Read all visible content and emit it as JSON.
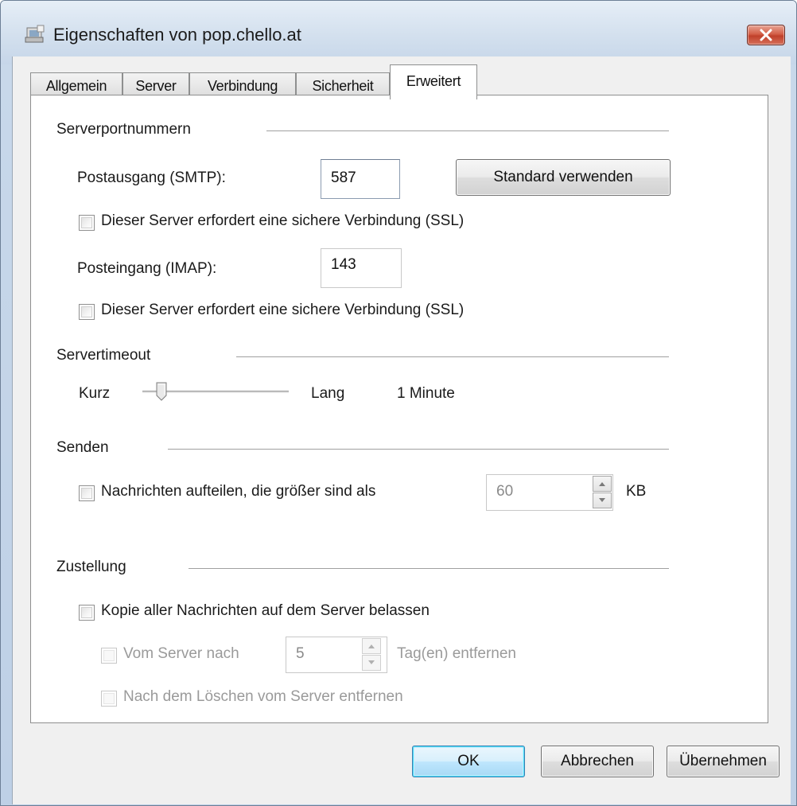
{
  "window": {
    "title": "Eigenschaften von pop.chello.at",
    "close_icon": "close-icon"
  },
  "tabs": [
    {
      "label": "Allgemein",
      "active": false
    },
    {
      "label": "Server",
      "active": false
    },
    {
      "label": "Verbindung",
      "active": false
    },
    {
      "label": "Sicherheit",
      "active": false
    },
    {
      "label": "Erweitert",
      "active": true
    }
  ],
  "ports": {
    "group_title": "Serverportnummern",
    "smtp_label": "Postausgang (SMTP):",
    "smtp_value": "587",
    "default_button": "Standard verwenden",
    "smtp_ssl_label": "Dieser Server erfordert eine sichere Verbindung (SSL)",
    "smtp_ssl_checked": false,
    "imap_label": "Posteingang (IMAP):",
    "imap_value": "143",
    "imap_ssl_label": "Dieser Server erfordert eine sichere Verbindung (SSL)",
    "imap_ssl_checked": false
  },
  "timeout": {
    "group_title": "Servertimeout",
    "min_label": "Kurz",
    "max_label": "Lang",
    "value_text": "1 Minute",
    "slider_fraction": 0.1
  },
  "send": {
    "group_title": "Senden",
    "split_label": "Nachrichten aufteilen, die größer sind als",
    "split_checked": false,
    "split_value": "60",
    "split_unit": "KB"
  },
  "delivery": {
    "group_title": "Zustellung",
    "keep_label": "Kopie aller Nachrichten auf dem Server belassen",
    "keep_checked": false,
    "remove_after_label": "Vom Server nach",
    "remove_after_value": "5",
    "remove_after_unit": "Tag(en) entfernen",
    "remove_on_delete_label": "Nach dem Löschen vom Server entfernen"
  },
  "footer": {
    "ok": "OK",
    "cancel": "Abbrechen",
    "apply": "Übernehmen"
  },
  "colors": {
    "close_button": "#c0402a",
    "default_button_border": "#3c7fb1",
    "disabled_text": "#9a9a9a"
  }
}
